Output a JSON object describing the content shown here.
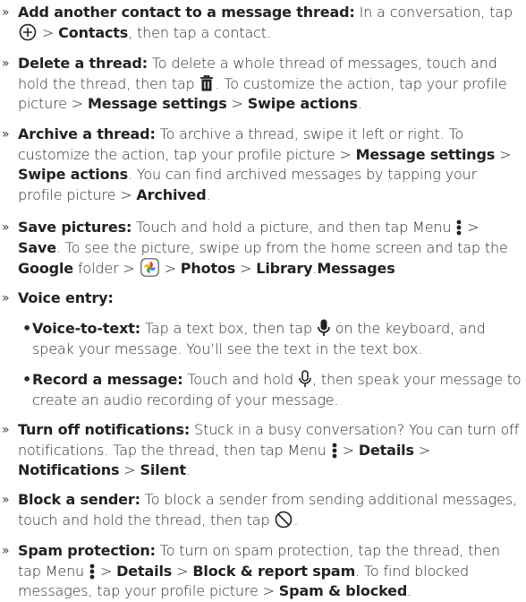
{
  "items": [
    {
      "id": "add",
      "bullet": "»",
      "bold": "Add another contact to a message thread:",
      "t1": " In a conversation, tap ",
      "t2": " > ",
      "b2": "Contacts",
      "t3": ", then tap a contact."
    },
    {
      "id": "delete",
      "bullet": "»",
      "bold": "Delete a thread:",
      "t1": " To delete a whole thread of messages, touch and hold the thread, then tap ",
      "t2": ". To customize the action, tap your profile picture > ",
      "b2": "Message settings",
      "t3": " > ",
      "b3": "Swipe actions",
      "t4": "."
    },
    {
      "id": "archive",
      "bullet": "»",
      "bold": "Archive a thread:",
      "t1": " To archive a thread, swipe it left or right. To customize the action, tap your profile picture > ",
      "b2": "Message settings",
      "t2": " > ",
      "b3": "Swipe actions",
      "t3": ". You can find archived messages by tapping your profile picture > ",
      "b4": "Archived",
      "t4": "."
    },
    {
      "id": "save",
      "bullet": "»",
      "bold": "Save pictures:",
      "t1": " Touch and hold a picture, and then tap Menu ",
      "t2": " > ",
      "b2": "Save",
      "t3": ". To see the picture, swipe up from the home screen and tap the ",
      "b3": "Google",
      "t4": " folder > ",
      "b4": "Photos",
      "t5": " > ",
      "b5": "Library",
      "t6": " > ",
      "b6": "Messages",
      "t7": "."
    },
    {
      "id": "voice",
      "bullet": "»",
      "bold": "Voice entry:"
    },
    {
      "id": "voice_text",
      "bullet": "•",
      "bold": "Voice-to-text:",
      "t1": " Tap a text box, then tap ",
      "t2": " on the keyboard, and speak your message. You’ll see the text in the text box."
    },
    {
      "id": "record",
      "bullet": "•",
      "bold": "Record a message:",
      "t1": " Touch and hold ",
      "t2": ", then speak your message to create an audio recording of your message."
    },
    {
      "id": "notif",
      "bullet": "»",
      "bold": "Turn off notifications:",
      "t1": " Stuck in a busy conversation? You can turn off notifications. Tap the thread, then tap Menu ",
      "t2": " > ",
      "b2": "Details",
      "t3": " > ",
      "b3": "Notifications",
      "t4": " > ",
      "b4": "Silent",
      "t5": "."
    },
    {
      "id": "block",
      "bullet": "»",
      "bold": "Block a sender:",
      "t1": " To block a sender from sending additional messages, touch and hold the thread, then tap ",
      "t2": "."
    },
    {
      "id": "spam",
      "bullet": "»",
      "bold": "Spam protection:",
      "t1": " To turn on spam protection, tap the thread, then tap Menu ",
      "t2": " > ",
      "b2": "Details",
      "t3": " > ",
      "b3": "Block & report spam",
      "t4": ". To find blocked messages, tap your profile picture > ",
      "b4": "Spam & blocked",
      "t5": "."
    }
  ],
  "icons": {
    "add": "add-circle-icon",
    "delete": "trash-icon",
    "menu": "more-vertical-icon",
    "photos": "google-photos-icon",
    "mic": "microphone-icon",
    "record": "record-mic-icon",
    "block": "block-icon"
  },
  "colors": {
    "text": "#2b2b2b",
    "bold": "#222222",
    "background": "#ffffff"
  }
}
